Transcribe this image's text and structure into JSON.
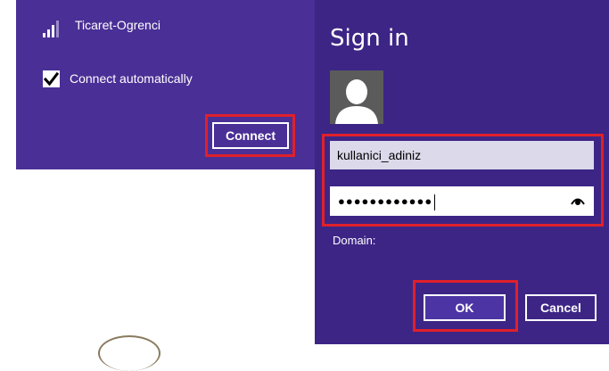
{
  "network": {
    "name": "Ticaret-Ogrenci",
    "signal_icon": "wifi-signal-icon",
    "connect_automatically_label": "Connect automatically",
    "connect_automatically_checked": true,
    "connect_label": "Connect"
  },
  "signin": {
    "title": "Sign in",
    "avatar_icon": "user-avatar-icon",
    "username_value": "kullanici_adiniz",
    "password_mask": "●●●●●●●●●●●●",
    "reveal_icon": "eye-icon",
    "domain_label": "Domain:",
    "ok_label": "OK",
    "cancel_label": "Cancel"
  },
  "colors": {
    "panel_left": "#4a2f96",
    "panel_right": "#3d2586",
    "highlight": "#e0202a"
  }
}
